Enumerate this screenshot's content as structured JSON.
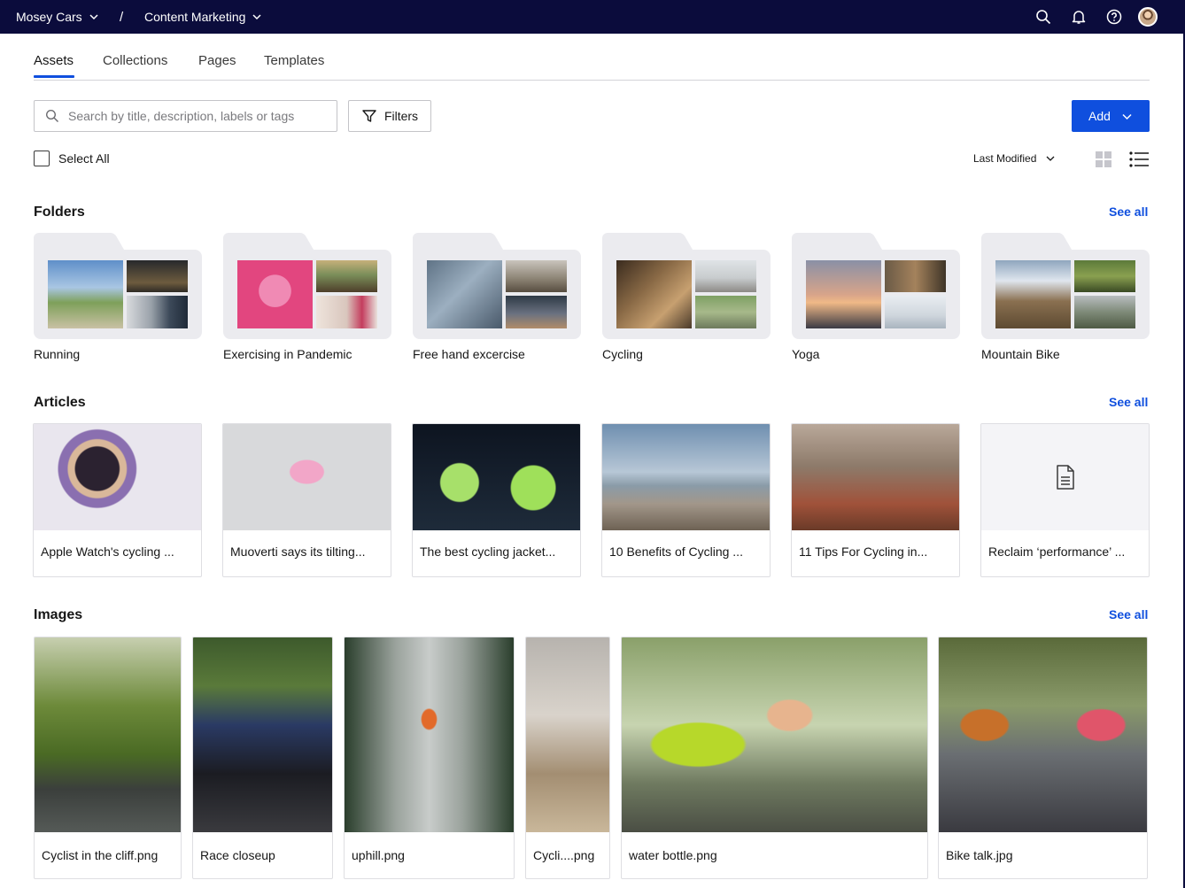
{
  "topbar": {
    "org": "Mosey Cars",
    "separator": "/",
    "workspace": "Content Marketing"
  },
  "tabs": [
    {
      "label": "Assets",
      "active": true
    },
    {
      "label": "Collections",
      "active": false
    },
    {
      "label": "Pages",
      "active": false
    },
    {
      "label": "Templates",
      "active": false
    }
  ],
  "toolbar": {
    "search_placeholder": "Search by title, description, labels or tags",
    "search_value": "",
    "filters_label": "Filters",
    "add_label": "Add",
    "select_all_label": "Select All",
    "sort_label": "Last Modified"
  },
  "sections": {
    "folders": {
      "title": "Folders",
      "see_all": "See all"
    },
    "articles": {
      "title": "Articles",
      "see_all": "See all"
    },
    "images": {
      "title": "Images",
      "see_all": "See all"
    }
  },
  "folders": [
    {
      "name": "Running"
    },
    {
      "name": "Exercising in Pandemic"
    },
    {
      "name": "Free hand excercise"
    },
    {
      "name": "Cycling"
    },
    {
      "name": "Yoga"
    },
    {
      "name": "Mountain Bike"
    }
  ],
  "articles": [
    {
      "title": "Apple Watch's cycling ..."
    },
    {
      "title": "Muoverti says its tilting..."
    },
    {
      "title": "The best cycling jacket..."
    },
    {
      "title": "10 Benefits of Cycling ..."
    },
    {
      "title": "11 Tips For Cycling in..."
    },
    {
      "title": "Reclaim ‘performance’ ..."
    }
  ],
  "images": [
    {
      "name": "Cyclist in the cliff.png"
    },
    {
      "name": "Race closeup"
    },
    {
      "name": "uphill.png"
    },
    {
      "name": "Cycli....png"
    },
    {
      "name": "water bottle.png"
    },
    {
      "name": "Bike talk.jpg"
    }
  ],
  "colors": {
    "topbar_bg": "#0b0c3c",
    "accent": "#0f4fde",
    "folder_bg": "#ebebef"
  }
}
